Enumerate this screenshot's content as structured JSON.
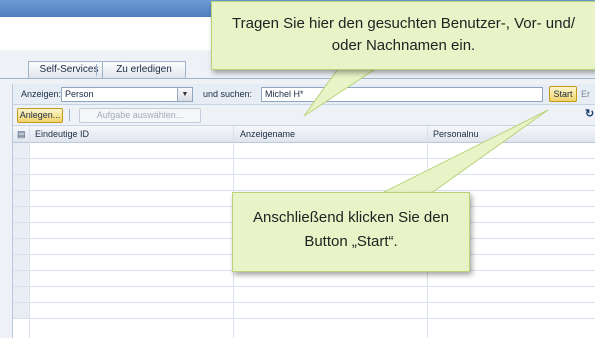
{
  "tabs": [
    {
      "label": "Self-Services"
    },
    {
      "label": "Zu erledigen"
    }
  ],
  "search": {
    "show_label": "Anzeigen:",
    "show_value": "Person",
    "and_search_label": "und suchen:",
    "query_value": "Michel H*",
    "start_label": "Start",
    "trailing_label": "Er"
  },
  "toolbar": {
    "create_label": "Anlegen...",
    "choose_task_label": "Aufgabe auswählen..."
  },
  "table": {
    "columns": [
      "Eindeutige ID",
      "Anzeigename",
      "Personalnu"
    ],
    "row_count": 11
  },
  "callouts": {
    "search_hint": "Tragen Sie hier den gesuchten Benutzer-, Vor- und/ oder Nachnamen ein.",
    "start_hint": "Anschließend klicken Sie den Button „Start“."
  },
  "icons": {
    "dropdown": "chevron-down-icon",
    "select_all": "table-select-icon",
    "refresh": "refresh-icon"
  },
  "colors": {
    "topbar": "#5a88c8",
    "start_button": "#f1d36b",
    "callout_bg": "#e8f3c8",
    "callout_border": "#b9d27a"
  }
}
